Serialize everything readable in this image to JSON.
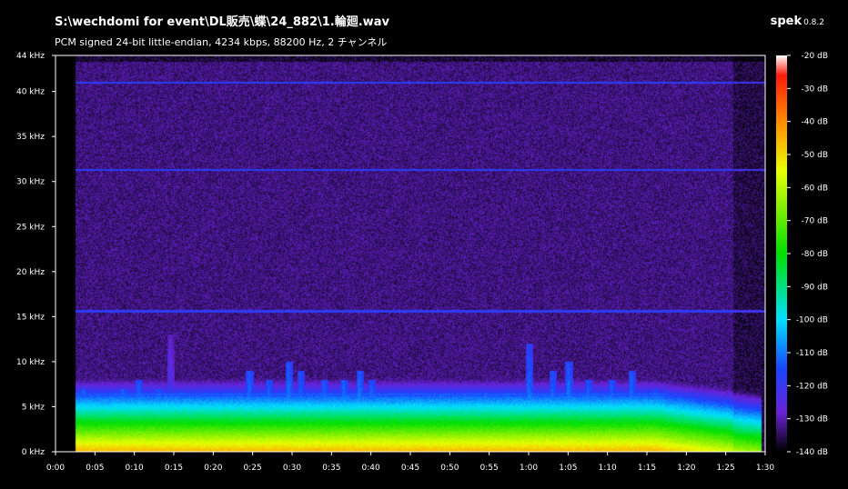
{
  "header": {
    "file_path": "S:\\wechdomi for event\\DL販売\\蝶\\24_882\\1.輪廻.wav",
    "format": "PCM signed 24-bit little-endian, 4234 kbps, 88200 Hz, 2 チャンネル",
    "app_name": "spek",
    "app_version": "0.8.2"
  },
  "chart_data": {
    "type": "heatmap",
    "title": "S:\\wechdomi for event\\DL販売\\蝶\\24_882\\1.輪廻.wav",
    "subtitle": "PCM signed 24-bit little-endian, 4234 kbps, 88200 Hz, 2 チャンネル",
    "x_axis": {
      "unit": "seconds",
      "range": [
        0,
        90
      ],
      "ticks": [
        0,
        5,
        10,
        15,
        20,
        25,
        30,
        35,
        40,
        45,
        50,
        55,
        60,
        65,
        70,
        75,
        80,
        85,
        90
      ],
      "tick_labels": [
        "0:00",
        "0:05",
        "0:10",
        "0:15",
        "0:20",
        "0:25",
        "0:30",
        "0:35",
        "0:40",
        "0:45",
        "0:50",
        "0:55",
        "1:00",
        "1:05",
        "1:10",
        "1:15",
        "1:20",
        "1:25",
        "1:30"
      ]
    },
    "y_axis": {
      "unit": "kHz",
      "range": [
        0,
        44
      ],
      "ticks": [
        0,
        5,
        10,
        15,
        20,
        25,
        30,
        35,
        40,
        44
      ],
      "tick_labels": [
        "0 kHz",
        "5 kHz",
        "10 kHz",
        "15 kHz",
        "20 kHz",
        "25 kHz",
        "30 kHz",
        "35 kHz",
        "40 kHz",
        "44 kHz"
      ]
    },
    "color_scale": {
      "unit": "dB",
      "range": [
        -140,
        -20
      ],
      "ticks": [
        -20,
        -30,
        -40,
        -50,
        -60,
        -70,
        -80,
        -90,
        -100,
        -110,
        -120,
        -130,
        -140
      ],
      "tick_labels": [
        "-20 dB",
        "-30 dB",
        "-40 dB",
        "-50 dB",
        "-60 dB",
        "-70 dB",
        "-80 dB",
        "-90 dB",
        "-100 dB",
        "-110 dB",
        "-120 dB",
        "-130 dB",
        "-140 dB"
      ],
      "stops": [
        {
          "db": -20,
          "color": "#ffffff"
        },
        {
          "db": -26,
          "color": "#ff1a0a"
        },
        {
          "db": -42,
          "color": "#ff9a00"
        },
        {
          "db": -55,
          "color": "#e8ff00"
        },
        {
          "db": -80,
          "color": "#00e000"
        },
        {
          "db": -100,
          "color": "#00e0ff"
        },
        {
          "db": -115,
          "color": "#1a44ff"
        },
        {
          "db": -128,
          "color": "#6a22d8"
        },
        {
          "db": -140,
          "color": "#000000"
        }
      ]
    },
    "spectrum": {
      "background_db": -133,
      "sample_rate_lines_khz": [
        15.6,
        31.3,
        41
      ],
      "loud_events": [
        {
          "t": 3.5,
          "top_khz": 7,
          "db": -104
        },
        {
          "t": 6,
          "top_khz": 5,
          "db": -108
        },
        {
          "t": 8.5,
          "top_khz": 7,
          "db": -104
        },
        {
          "t": 10.5,
          "top_khz": 8,
          "db": -104
        },
        {
          "t": 13,
          "top_khz": 7,
          "db": -104
        },
        {
          "t": 14.5,
          "top_khz": 13,
          "db": -112
        },
        {
          "t": 17.5,
          "top_khz": 6,
          "db": -106
        },
        {
          "t": 21,
          "top_khz": 5,
          "db": -110
        },
        {
          "t": 24.5,
          "top_khz": 9,
          "db": -103
        },
        {
          "t": 27,
          "top_khz": 8,
          "db": -104
        },
        {
          "t": 29.5,
          "top_khz": 10,
          "db": -102
        },
        {
          "t": 31,
          "top_khz": 9,
          "db": -104
        },
        {
          "t": 34,
          "top_khz": 8,
          "db": -104
        },
        {
          "t": 36.5,
          "top_khz": 8,
          "db": -103
        },
        {
          "t": 38.5,
          "top_khz": 9,
          "db": -102
        },
        {
          "t": 40,
          "top_khz": 8,
          "db": -104
        },
        {
          "t": 43,
          "top_khz": 6,
          "db": -106
        },
        {
          "t": 47.5,
          "top_khz": 6,
          "db": -107
        },
        {
          "t": 51,
          "top_khz": 5,
          "db": -109
        },
        {
          "t": 60,
          "top_khz": 12,
          "db": -102
        },
        {
          "t": 63,
          "top_khz": 9,
          "db": -104
        },
        {
          "t": 65,
          "top_khz": 10,
          "db": -102
        },
        {
          "t": 67.5,
          "top_khz": 8,
          "db": -104
        },
        {
          "t": 70.5,
          "top_khz": 8,
          "db": -104
        },
        {
          "t": 73,
          "top_khz": 9,
          "db": -103
        },
        {
          "t": 76,
          "top_khz": 7,
          "db": -106
        },
        {
          "t": 79,
          "top_khz": 6,
          "db": -107
        }
      ]
    },
    "grid": false
  }
}
